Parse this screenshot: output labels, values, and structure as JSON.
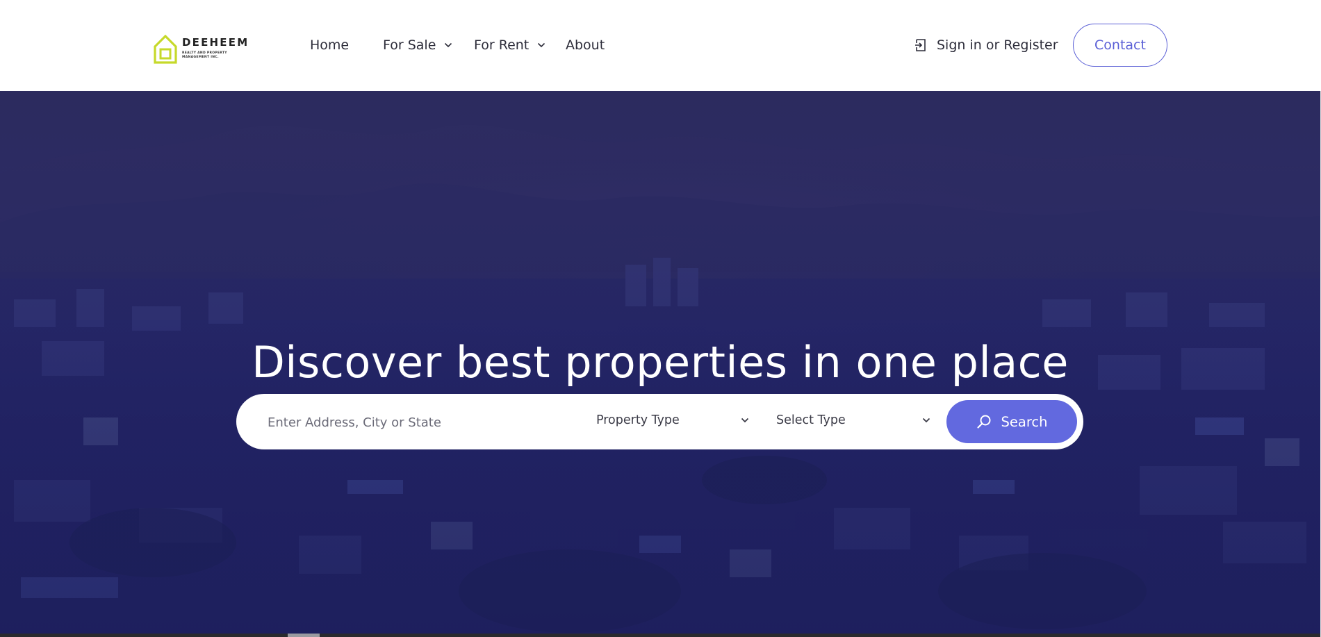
{
  "brand": {
    "name": "DEEHEEM",
    "tagline": "REALTY AND PROPERTY MANAGEMENT INC.",
    "logo_color": "#c6d92a"
  },
  "nav": {
    "items": [
      {
        "label": "Home",
        "dropdown": false
      },
      {
        "label": "For Sale",
        "dropdown": true
      },
      {
        "label": "For Rent",
        "dropdown": true
      },
      {
        "label": "About",
        "dropdown": false
      }
    ],
    "signin_label": "Sign in or Register",
    "contact_label": "Contact"
  },
  "hero": {
    "title": "Discover best properties in one place",
    "search": {
      "address_placeholder": "Enter Address, City or State",
      "property_type": "Property Type",
      "select_type": "Select Type",
      "button_label": "Search"
    }
  },
  "colors": {
    "accent": "#6269df",
    "contact_border": "#5a5fd6",
    "hero_overlay": "#23245f",
    "text_dark": "#2d2d3a"
  },
  "icons": {
    "signin": "login-icon",
    "dropdown": "chevron-down-icon",
    "search": "search-icon",
    "logo": "house-icon"
  }
}
